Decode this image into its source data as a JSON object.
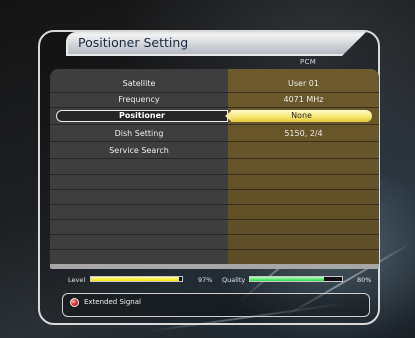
{
  "window": {
    "title": "Positioner Setting",
    "subtitle": "PCM"
  },
  "rows": [
    {
      "label": "Satellite",
      "value": "User 01"
    },
    {
      "label": "Frequency",
      "value": "4071 MHz"
    },
    {
      "label": "Positioner",
      "value": "None"
    },
    {
      "label": "Dish Setting",
      "value": "5150, 2/4"
    },
    {
      "label": "Service Search",
      "value": ""
    }
  ],
  "signal": {
    "level_label": "Level",
    "level_value": "97%",
    "level_fraction": 0.97,
    "quality_label": "Quality",
    "quality_value": "80%",
    "quality_fraction": 0.8,
    "level_color": "#f3e200",
    "quality_color": "#27d642"
  },
  "status": {
    "text": "Extended Signal"
  },
  "colors": {
    "selection_highlight": "#f5e46a",
    "value_column": "#6d5a2c",
    "label_column": "#3e3e3e"
  }
}
